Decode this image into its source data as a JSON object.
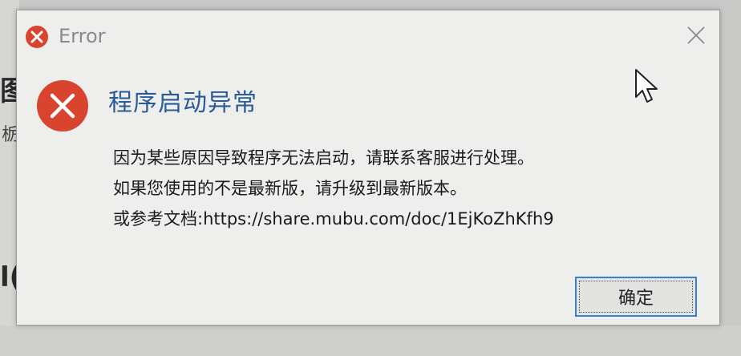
{
  "background": {
    "glyph_1": "图",
    "glyph_2": "栃",
    "glyph_3": "l("
  },
  "dialog": {
    "title": "Error",
    "heading": "程序启动异常",
    "message_lines": [
      "因为某些原因导致程序无法启动，请联系客服进行处理。",
      "如果您使用的不是最新版，请升级到最新版本。",
      "或参考文档:https://share.mubu.com/doc/1EjKoZhKfh9"
    ],
    "ok_label": "确定",
    "icons": {
      "title": "error-icon",
      "main": "error-icon",
      "close": "close-icon",
      "pointer": "mouse-pointer-icon"
    },
    "colors": {
      "error_red": "#d9442e",
      "heading_blue": "#2a5a9a",
      "focus_blue": "#3c7fd0"
    }
  }
}
